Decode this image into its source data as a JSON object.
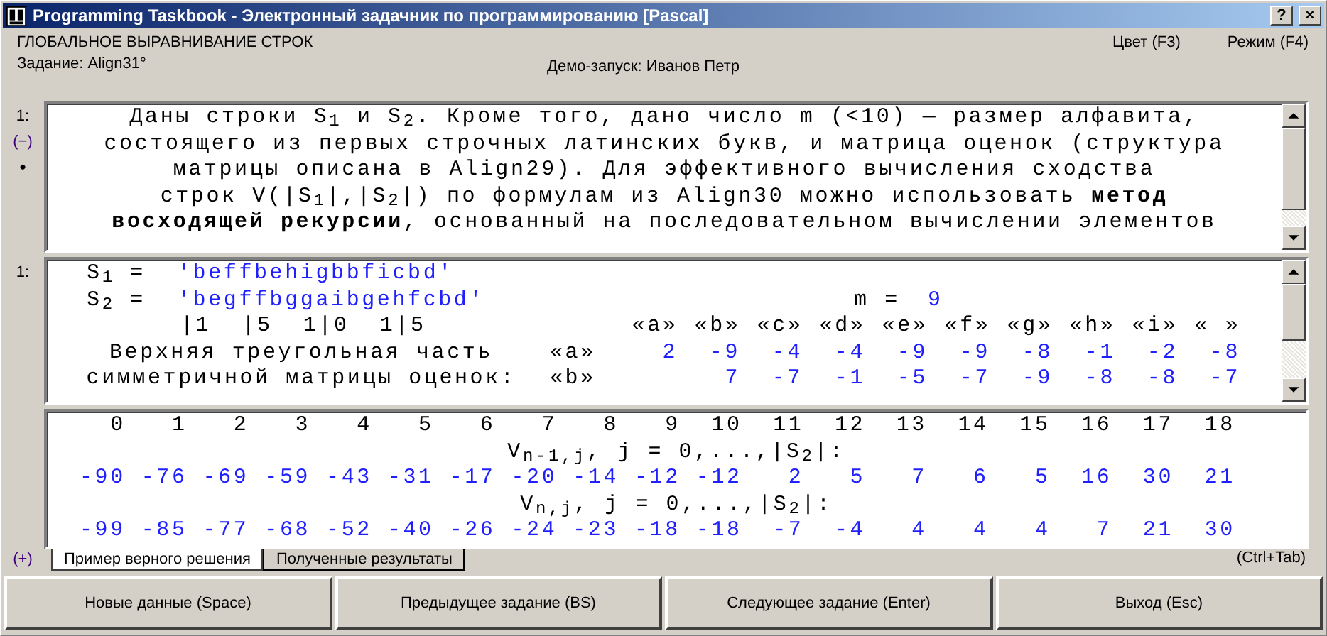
{
  "window": {
    "title": "Programming Taskbook - Электронный задачник по программированию [Pascal]",
    "buttons": [
      "?",
      "×"
    ]
  },
  "header": {
    "title": "ГЛОБАЛЬНОЕ ВЫРАВНИВАНИЕ СТРОК",
    "task": "Задание: Align31°",
    "demo": "Демо-запуск: Иванов Петр",
    "links": [
      "Цвет (F3)",
      "Режим (F4)"
    ]
  },
  "task_panel": {
    "marks": [
      "1:",
      "(−)",
      "•"
    ],
    "lines": [
      "Даны строки S$_{1}$ и S$_{2}$. Кроме того, дано число m (<10) — размер алфавита,",
      "состоящего из первых строчных латинских букв, и матрица оценок (структура",
      "матрицы описана в Align29). Для эффективного вычисления сходства",
      "строк V(|S$_{1}$|,|S$_{2}$|) по формулам из Align30 можно использовать **метод**",
      "**восходящей рекурсии**, основанный на последовательном вычислении элементов"
    ]
  },
  "input_panel": {
    "mark": "1:",
    "strings": [
      {
        "label": "S$_{1}$ =",
        "value": "'beffbehigbbficbd'"
      },
      {
        "label": "S$_{2}$ =",
        "value": "'begffbggaibgehfcbd'"
      }
    ],
    "m": {
      "label": "m =",
      "value": "9"
    },
    "ruler": "|1  |5  1|0  1|5",
    "columns": [
      "«a»",
      "«b»",
      "«c»",
      "«d»",
      "«e»",
      "«f»",
      "«g»",
      "«h»",
      "«i»",
      "« »"
    ],
    "rows": [
      {
        "caption": "Верхняя треугольная часть",
        "letter": "«a»",
        "values": [
          "2",
          "-9",
          "-4",
          "-4",
          "-9",
          "-9",
          "-8",
          "-1",
          "-2",
          "-8"
        ]
      },
      {
        "caption": "симметричной матрицы оценок:",
        "letter": "«b»",
        "values": [
          "7",
          "-7",
          "-1",
          "-5",
          "-7",
          "-9",
          "-8",
          "-8",
          "-7"
        ]
      }
    ]
  },
  "result_panel": {
    "mark": "(+)",
    "indices": [
      "0",
      "1",
      "2",
      "3",
      "4",
      "5",
      "6",
      "7",
      "8",
      "9",
      "10",
      "11",
      "12",
      "13",
      "14",
      "15",
      "16",
      "17",
      "18"
    ],
    "blocks": [
      {
        "label": "V$_{n-1,j}$, j = 0,...,|S$_{2}$|:",
        "values": [
          "-90",
          "-76",
          "-69",
          "-59",
          "-43",
          "-31",
          "-17",
          "-20",
          "-14",
          "-12",
          "-12",
          "2",
          "5",
          "7",
          "6",
          "5",
          "16",
          "30",
          "21"
        ]
      },
      {
        "label": "V$_{n,j}$, j = 0,...,|S$_{2}$|:",
        "values": [
          "-99",
          "-85",
          "-77",
          "-68",
          "-52",
          "-40",
          "-26",
          "-24",
          "-23",
          "-18",
          "-18",
          "-7",
          "-4",
          "4",
          "4",
          "4",
          "7",
          "21",
          "30"
        ]
      }
    ]
  },
  "tabs": [
    {
      "label": "Пример верного решения",
      "selected": true
    },
    {
      "label": "Полученные результаты",
      "selected": false
    }
  ],
  "tab_hint": "(Ctrl+Tab)",
  "buttons": [
    "Новые данные (Space)",
    "Предыдущее задание (BS)",
    "Следующее задание (Enter)",
    "Выход (Esc)"
  ]
}
